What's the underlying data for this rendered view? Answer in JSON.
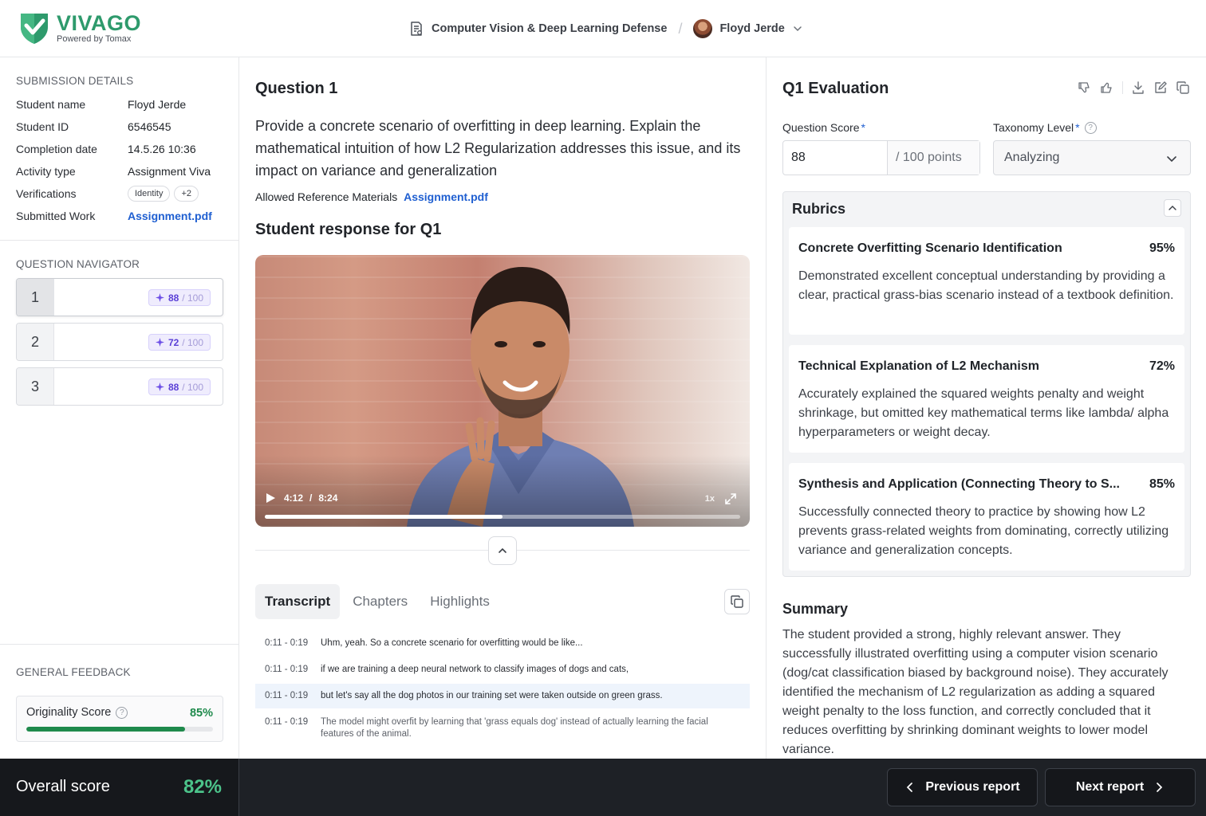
{
  "brand": {
    "name": "VIVAGO",
    "tagline": "Powered by Tomax",
    "accent": "#2e9a6c"
  },
  "header": {
    "course": "Computer Vision & Deep Learning Defense",
    "student": "Floyd Jerde"
  },
  "submission": {
    "title": "SUBMISSION DETAILS",
    "rows": [
      {
        "k": "Student name",
        "v": "Floyd Jerde"
      },
      {
        "k": "Student ID",
        "v": "6546545"
      },
      {
        "k": "Completion date",
        "v": "14.5.26 10:36"
      },
      {
        "k": "Activity type",
        "v": "Assignment Viva"
      },
      {
        "k": "Verifications",
        "pill1": "Identity",
        "pill2": "+2"
      },
      {
        "k": "Submitted Work",
        "v": "Assignment.pdf"
      }
    ]
  },
  "navigator": {
    "title": "QUESTION NAVIGATOR",
    "items": [
      {
        "n": "1",
        "score": "88",
        "total": "/ 100"
      },
      {
        "n": "2",
        "score": "72",
        "total": "/ 100"
      },
      {
        "n": "3",
        "score": "88",
        "total": "/ 100"
      }
    ]
  },
  "feedback": {
    "title": "GENERAL FEEDBACK",
    "originality_label": "Originality Score",
    "originality_value": "85%",
    "originality_fraction": 0.85
  },
  "question": {
    "title": "Question 1",
    "text": "Provide a concrete scenario of overfitting in deep learning. Explain the mathematical intuition of how L2 Regularization addresses this issue, and its impact on variance and generalization",
    "ref_label": "Allowed Reference Materials",
    "ref_link": "Assignment.pdf",
    "response_title": "Student response for Q1"
  },
  "video": {
    "current": "4:12",
    "separator": "/",
    "duration": "8:24",
    "speed": "1x",
    "progress_fraction": 0.5
  },
  "tabs": [
    "Transcript",
    "Chapters",
    "Highlights"
  ],
  "transcript": [
    {
      "t": "0:11 - 0:19",
      "text": "Uhm, yeah. So a concrete scenario for overfitting would be like..."
    },
    {
      "t": "0:11 - 0:19",
      "text": "if we are training a deep neural network to classify images of dogs and cats,"
    },
    {
      "t": "0:11 - 0:19",
      "text": "but let's say all the dog photos in our training set were taken outside on green grass."
    },
    {
      "t": "0:11 - 0:19",
      "text": "The model might overfit by learning that 'grass equals dog' instead of actually learning the facial features of the animal."
    }
  ],
  "evaluation": {
    "title": "Q1 Evaluation",
    "score_label": "Question Score",
    "score_value": "88",
    "score_suffix": "/ 100 points",
    "taxonomy_label": "Taxonomy Level",
    "taxonomy_value": "Analyzing",
    "required_mark": "*",
    "rubrics_title": "Rubrics",
    "rubrics": [
      {
        "name": "Concrete Overfitting Scenario Identification",
        "pct": "95%",
        "desc": "Demonstrated excellent conceptual understanding by providing a clear, practical grass-bias scenario instead of a textbook definition."
      },
      {
        "name": "Technical Explanation of L2 Mechanism",
        "pct": "72%",
        "desc": "Accurately explained the squared weights penalty and weight shrinkage, but omitted key mathematical terms like lambda/ alpha hyperparameters or weight decay."
      },
      {
        "name": "Synthesis and Application (Connecting Theory to S...",
        "pct": "85%",
        "desc": "Successfully connected theory to practice by showing how L2 prevents grass-related weights from dominating, correctly utilizing variance and generalization concepts."
      }
    ],
    "summary_title": "Summary",
    "summary_text": "The student provided a strong, highly relevant answer. They successfully illustrated overfitting using a computer vision scenario (dog/cat classification biased by background noise). They accurately identified the mechanism of L2 regularization as adding a squared weight penalty to the loss function, and correctly concluded that it reduces overfitting by shrinking dominant weights to lower model variance."
  },
  "footer": {
    "overall_label": "Overall score",
    "overall_value": "82%",
    "prev_label": "Previous report",
    "next_label": "Next report"
  }
}
